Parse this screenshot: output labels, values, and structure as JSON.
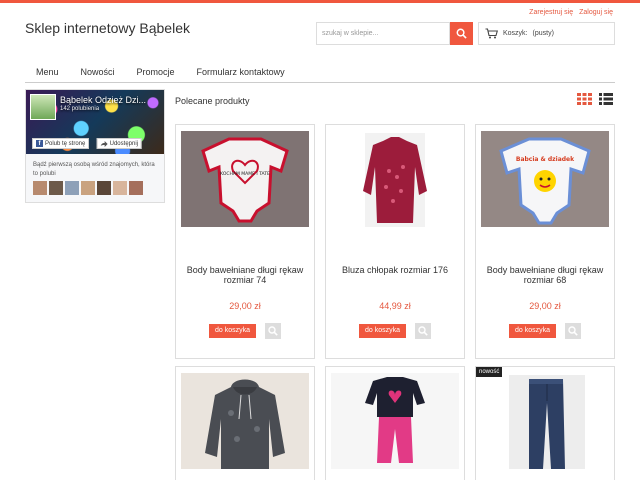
{
  "header": {
    "shop_title": "Sklep internetowy Bąbelek",
    "register_link": "Zarejestruj się",
    "login_link": "Zaloguj się",
    "search_placeholder": "szukaj w sklepie...",
    "cart_label": "Koszyk:",
    "cart_status": "(pusty)",
    "accent_color": "#f0573e"
  },
  "nav": {
    "items": [
      {
        "label": "Menu"
      },
      {
        "label": "Nowości"
      },
      {
        "label": "Promocje"
      },
      {
        "label": "Formularz kontaktowy"
      }
    ]
  },
  "facebook_widget": {
    "page_name": "Bąbelek Odzież Dzi...",
    "likes": "142 polubienia",
    "like_button": "Polub tę stronę",
    "share_button": "Udostępnij",
    "friends_text": "Bądź pierwszą osobą wśród znajomych, która to polubi"
  },
  "main": {
    "section_title": "Polecane produkty",
    "products": [
      {
        "name": "Body bawełniane długi rękaw rozmiar 74",
        "price": "29,00 zł",
        "add_label": "do koszyka"
      },
      {
        "name": "Bluza chłopak rozmiar 176",
        "price": "44,99 zł",
        "add_label": "do koszyka"
      },
      {
        "name": "Body bawełniane długi rękaw rozmiar 68",
        "price": "29,00 zł",
        "add_label": "do koszyka"
      },
      {
        "name": "",
        "price": "",
        "add_label": ""
      },
      {
        "name": "",
        "price": "",
        "add_label": ""
      },
      {
        "name": "",
        "price": "",
        "add_label": "",
        "badge": "nowość"
      }
    ]
  },
  "body_print_text_1": "KOCHAM MAME I TATE",
  "body_print_text_3": "Babcia & dziadek"
}
